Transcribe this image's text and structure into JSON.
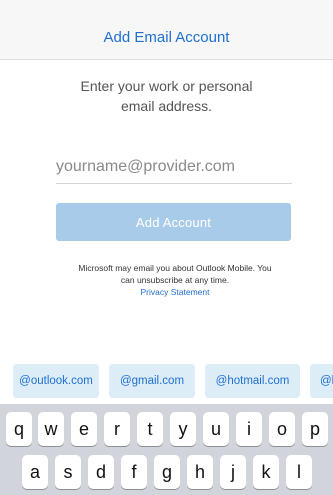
{
  "header": {
    "title": "Add Email Account"
  },
  "prompt": {
    "line1": "Enter your work or personal",
    "line2": "email address."
  },
  "email_input": {
    "value": "",
    "placeholder": "yourname@provider.com"
  },
  "add_button": {
    "label": "Add Account"
  },
  "disclaimer": {
    "line1": "Microsoft may email you about Outlook Mobile. You",
    "line2": "can unsubscribe at any time.",
    "link": "Privacy Statement"
  },
  "suggestions": [
    "@outlook.com",
    "@gmail.com",
    "@hotmail.com",
    "@l"
  ],
  "keyboard": {
    "row1": [
      "q",
      "w",
      "e",
      "r",
      "t",
      "y",
      "u",
      "i",
      "o",
      "p"
    ],
    "row2": [
      "a",
      "s",
      "d",
      "f",
      "g",
      "h",
      "j",
      "k",
      "l"
    ]
  },
  "colors": {
    "accent": "#1f6fd1",
    "button_disabled": "#a8cbe9",
    "suggestion_bg": "#dcedf8",
    "keyboard_bg": "#d1d5db"
  }
}
